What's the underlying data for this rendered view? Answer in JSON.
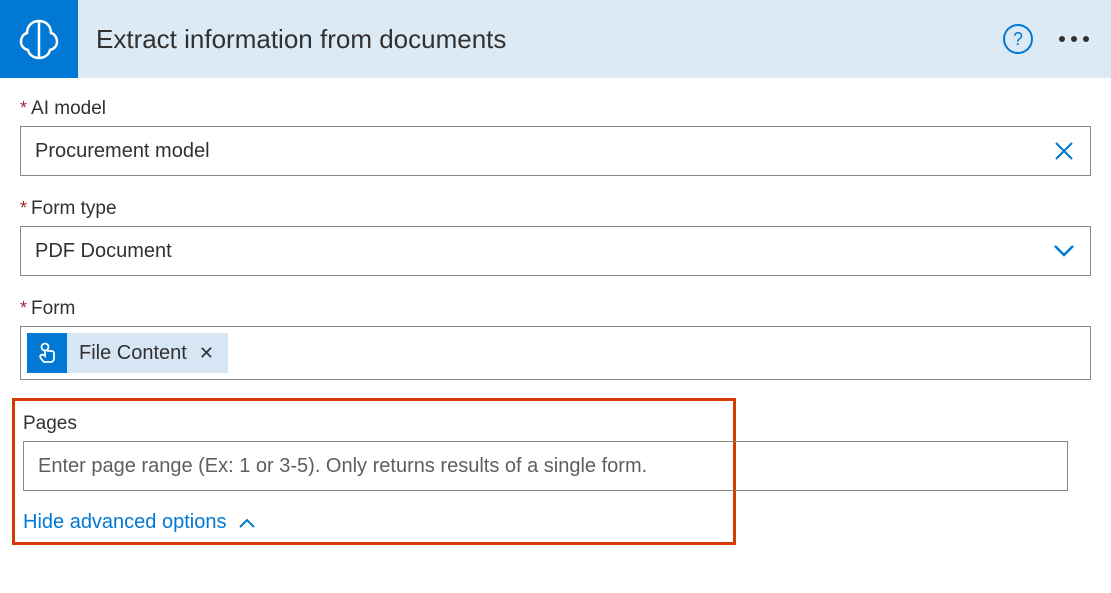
{
  "header": {
    "title": "Extract information from documents"
  },
  "fields": {
    "ai_model": {
      "label": "AI model",
      "value": "Procurement model"
    },
    "form_type": {
      "label": "Form type",
      "value": "PDF Document"
    },
    "form": {
      "label": "Form",
      "token_label": "File Content"
    },
    "pages": {
      "label": "Pages",
      "placeholder": "Enter page range (Ex: 1 or 3-5). Only returns results of a single form."
    }
  },
  "advanced": {
    "toggle_label": "Hide advanced options"
  }
}
